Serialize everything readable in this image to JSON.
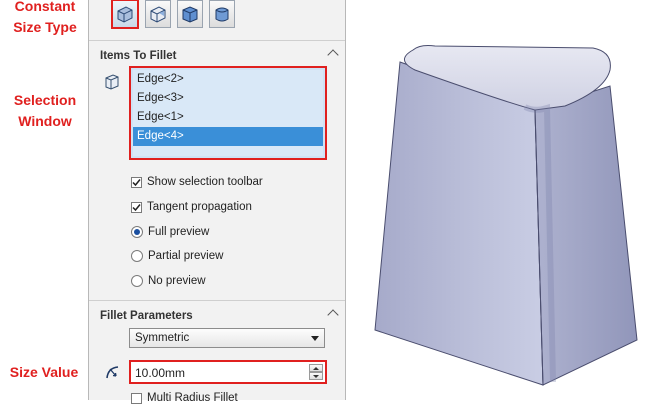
{
  "annotations": {
    "constant_size_type": "Constant\nSize Type",
    "selection_window": "Selection\nWindow",
    "size_value": "Size Value"
  },
  "fillet_type_buttons": [
    {
      "name": "constant-size-fillet",
      "selected": true
    },
    {
      "name": "variable-size-fillet",
      "selected": false
    },
    {
      "name": "face-fillet",
      "selected": false
    },
    {
      "name": "full-round-fillet",
      "selected": false
    }
  ],
  "items_to_fillet": {
    "title": "Items To Fillet",
    "edges": [
      "Edge<2>",
      "Edge<3>",
      "Edge<1>",
      "Edge<4>"
    ],
    "active_edge_index": 3,
    "show_selection_toolbar": {
      "label": "Show selection toolbar",
      "checked": true
    },
    "tangent_propagation": {
      "label": "Tangent propagation",
      "checked": true
    },
    "preview_options": [
      {
        "label": "Full preview",
        "selected": true
      },
      {
        "label": "Partial preview",
        "selected": false
      },
      {
        "label": "No preview",
        "selected": false
      }
    ]
  },
  "fillet_parameters": {
    "title": "Fillet Parameters",
    "profile_value": "Symmetric",
    "radius_value": "10.00mm",
    "multi_radius_label": "Multi Radius Fillet"
  },
  "colors": {
    "annotation_red": "#e0201f",
    "selection_blue": "#3a8fd8",
    "model_face": "#b7bbd3"
  }
}
